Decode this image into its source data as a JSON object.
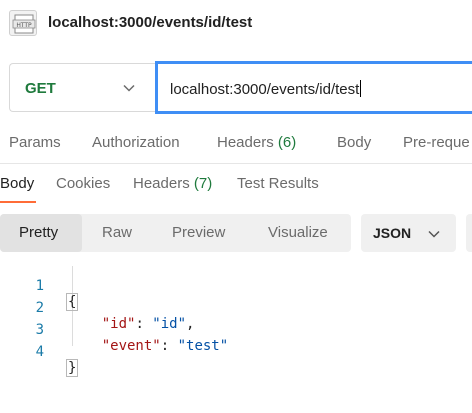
{
  "request": {
    "title": "localhost:3000/events/id/test",
    "icon": "http-file-icon",
    "method": "GET",
    "url": "localhost:3000/events/id/test"
  },
  "request_tabs": {
    "params": "Params",
    "authorization": "Authorization",
    "headers": "Headers",
    "headers_count": "(6)",
    "body": "Body",
    "pre_request": "Pre-reque"
  },
  "response_tabs": {
    "body": "Body",
    "cookies": "Cookies",
    "headers": "Headers",
    "headers_count": "(7)",
    "test_results": "Test Results"
  },
  "view": {
    "options": [
      "Pretty",
      "Raw",
      "Preview",
      "Visualize"
    ],
    "selected": "Pretty",
    "format": "JSON"
  },
  "code": {
    "line_numbers": [
      "1",
      "2",
      "3",
      "4"
    ],
    "open_brace": "{",
    "close_brace": "}",
    "entries": [
      {
        "key": "\"id\"",
        "value": "\"id\"",
        "trail": ","
      },
      {
        "key": "\"event\"",
        "value": "\"test\"",
        "trail": ""
      }
    ]
  },
  "colors": {
    "method_get": "#1f7a3d",
    "focus_border": "#3f8ef5",
    "active_tab_underline": "#ff6c37",
    "json_key": "#a31515",
    "json_string": "#0451a5",
    "line_number": "#1b7ba8"
  }
}
